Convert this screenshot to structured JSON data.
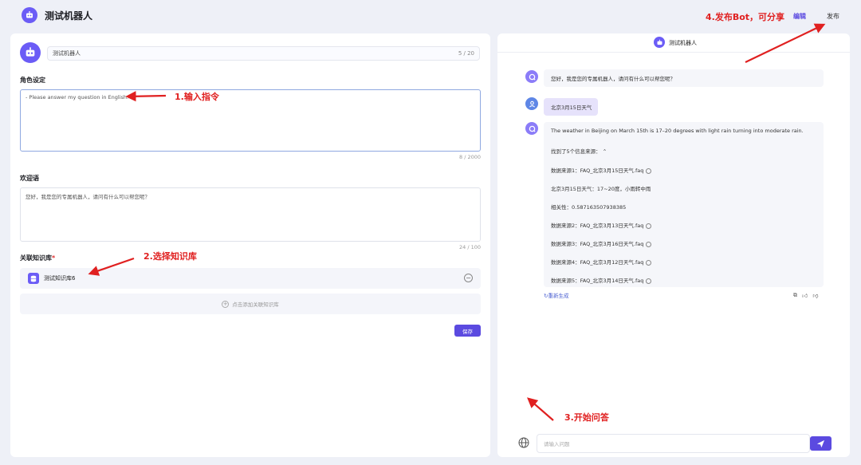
{
  "header": {
    "bot_name": "测试机器人",
    "edit_label": "编辑",
    "publish_label": "发布"
  },
  "config": {
    "name_value": "测试机器人",
    "name_count": "5 / 20",
    "role_label": "角色设定",
    "role_value": "- Please answer my question in English.",
    "role_count": "8 / 2000",
    "welcome_label": "欢迎语",
    "welcome_value": "您好，我是您的专属机器人，请问有什么可以帮您呢？",
    "welcome_count": "24 / 100",
    "kb_label": "关联知识库",
    "kb_required_mark": "*",
    "kb_items": [
      {
        "name": "测试知识库6"
      }
    ],
    "kb_add_label": "点击添加关联知识库",
    "save_label": "保存"
  },
  "chat": {
    "title": "测试机器人",
    "messages": [
      {
        "role": "bot",
        "text": "您好，我是您的专属机器人，请问有什么可以帮您呢？"
      },
      {
        "role": "user",
        "text": "北京3月15日天气"
      },
      {
        "role": "bot",
        "text": "The weather in Beijing on March 15th is 17–20 degrees with light rain turning into moderate rain.",
        "sources_header": "找到了5个信息来源：",
        "source_lines": [
          "数据来源1：FAQ_北京3月15日天气.faq",
          "北京3月15日天气：17~20度，小雨转中雨",
          "相关性：0.587163507938385",
          "数据来源2：FAQ_北京3月13日天气.faq",
          "数据来源3：FAQ_北京3月16日天气.faq",
          "数据来源4：FAQ_北京3月12日天气.faq",
          "数据来源5：FAQ_北京3月14日天气.faq"
        ]
      }
    ],
    "regenerate_label": "重新生成",
    "input_placeholder": "请输入问题"
  },
  "annotations": {
    "step1": "1.输入指令",
    "step2": "2.选择知识库",
    "step3": "3.开始问答",
    "step4": "4.发布Bot，可分享"
  },
  "colors": {
    "accent": "#5b4ae0",
    "annotation": "#e02020"
  }
}
